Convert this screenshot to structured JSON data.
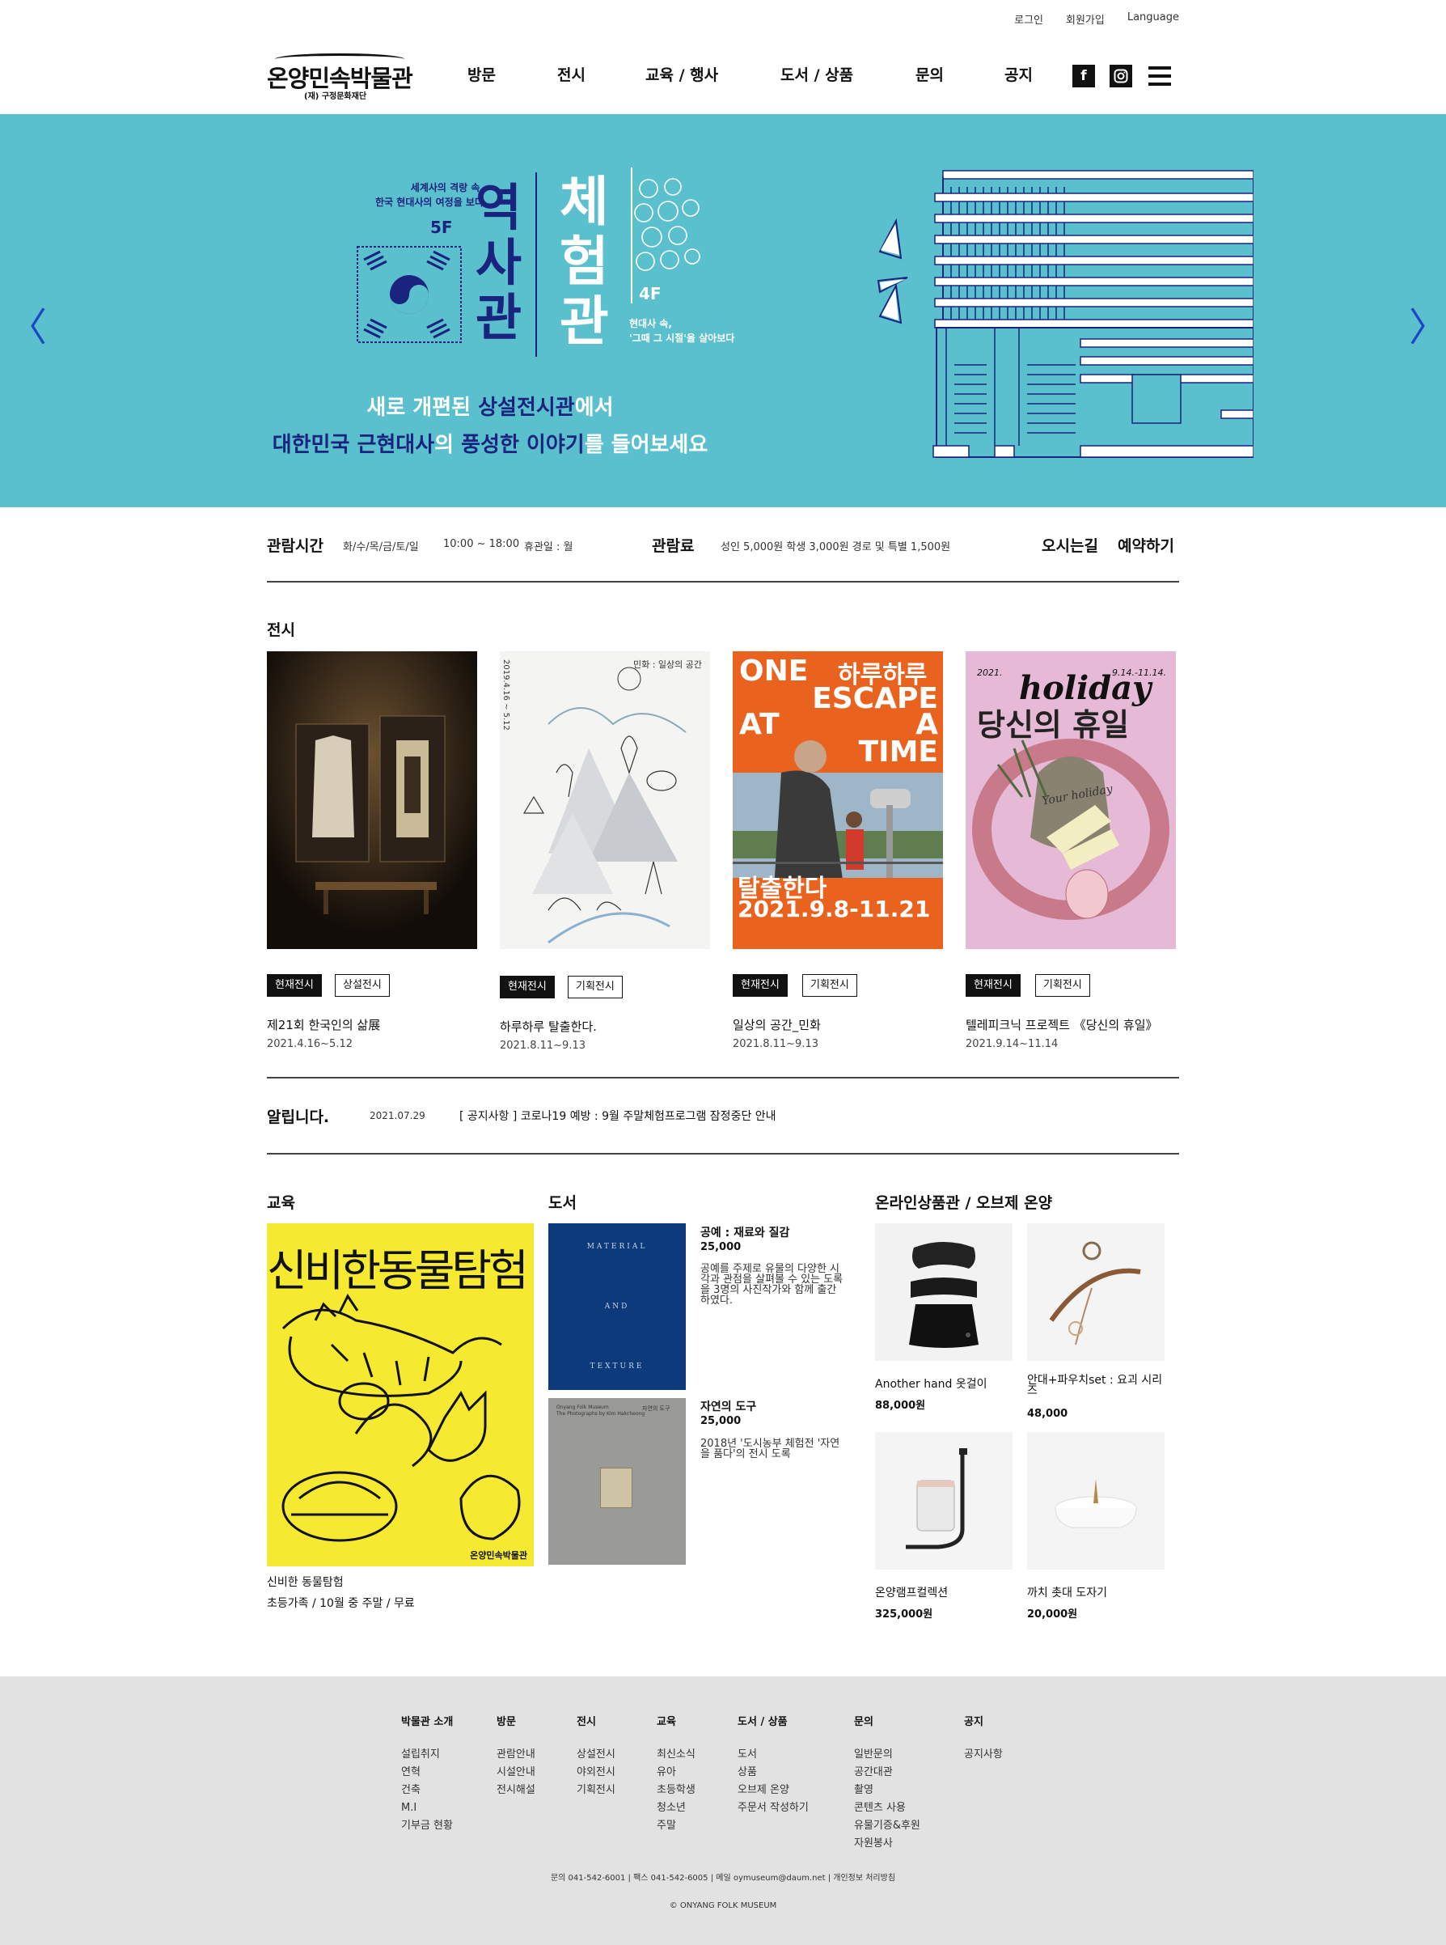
{
  "util": {
    "login": "로그인",
    "join": "회원가입",
    "language": "Language"
  },
  "logo": {
    "title": "온양민속박물관",
    "sub": "(재) 구정문화재단"
  },
  "gnb": [
    "방문",
    "전시",
    "교육 / 행사",
    "도서 / 상품",
    "문의",
    "공지"
  ],
  "sns": {
    "facebook": "f",
    "instagram": "◘"
  },
  "hero": {
    "left_text": "세계사의 격랑 속,\n한국 현대사의 여정을 보다",
    "floor5": "5F",
    "hall1": "역사관",
    "hall2": "체험관",
    "floor4": "4F",
    "right_text": "현대사 속,\n'그때 그 시절'을 살아보다",
    "line1_a": "새로 개편된 ",
    "line1_b": "상설전시관",
    "line1_c": "에서",
    "line2_a": "대한민국 근현대사",
    "line2_b": "의 ",
    "line2_c": "풍성한 이야기",
    "line2_d": "를 들어보세요"
  },
  "info": {
    "hours_title": "관람시간",
    "hours_days": "화/수/목/금/토/일",
    "hours_time": "10:00 ~ 18:00",
    "closed": "휴관일 : 월",
    "fee_title": "관람료",
    "fee": "성인 5,000원 학생 3,000원 경로 및 특별 1,500원",
    "directions": "오시는길",
    "reserve": "예약하기"
  },
  "exhibit": {
    "title": "전시",
    "items": [
      {
        "tag1": "현재전시",
        "tag2": "상설전시",
        "title": "제21회 한국인의 삶展",
        "date": "2021.4.16~5.12"
      },
      {
        "tag1": "현재전시",
        "tag2": "기획전시",
        "title": "하루하루 탈출한다.",
        "date": "2021.8.11~9.13"
      },
      {
        "tag1": "현재전시",
        "tag2": "기획전시",
        "title": "일상의 공간_민화",
        "date": "2021.8.11~9.13"
      },
      {
        "tag1": "현재전시",
        "tag2": "기획전시",
        "title": "텔레피크닉 프로젝트 《당신의 휴일》",
        "date": "2021.9.14~11.14"
      }
    ],
    "poster2_title": "민화 : 일상의 공간",
    "poster2_date": "2019.4.16 ~ 5.12",
    "poster3_lines": [
      "ONE",
      "하루하루",
      "ESCAPE",
      "AT",
      "A",
      "TIME"
    ],
    "poster3_sub": "탈출한다",
    "poster3_date": "2021.9.8-11.21",
    "poster4_top": "holiday",
    "poster4_kr": "당신의 휴일",
    "poster4_year": "2021.",
    "poster4_range": "9.14.-11.14.",
    "poster4_script": "Your holiday"
  },
  "notice": {
    "title": "알립니다.",
    "date": "2021.07.29",
    "text": "[ 공지사항 ] 코로나19 예방 : 9월 주말체험프로그램 잠정중단 안내"
  },
  "education": {
    "title": "교육",
    "poster_title": "신비한동물탐험",
    "poster_brand": "온양민속박물관",
    "item_title": "신비한 동물탐험",
    "item_desc": "초등가족 / 10월 중 주말 / 무료"
  },
  "books": {
    "title": "도서",
    "items": [
      {
        "title": "공예 : 재료와 질감",
        "price": "25,000",
        "desc": "공예를 주제로 유물의 다양한 시각과 관점을 살펴볼 수 있는 도록을 3명의 사진작가와 함께 출간하였다."
      },
      {
        "title": "자연의 도구",
        "price": "25,000",
        "desc": "2018년 '도시농부 체험전 '자연을 품다'의 전시 도록"
      }
    ],
    "cover1": [
      "MATERIAL",
      "AND",
      "TEXTURE"
    ],
    "cover2_top": "Onyang Folk Museum",
    "cover2_sub": "The Photographs by Kim Hakcheong",
    "cover2_right": "자연의 도구"
  },
  "shop": {
    "title": "온라인상품관 / 오브제 온양",
    "items": [
      {
        "name": "Another hand 옷걸이",
        "price": "88,000원"
      },
      {
        "name": "안대+파우치set : 요괴 시리즈",
        "price": "48,000"
      },
      {
        "name": "온양램프컬렉션",
        "price": "325,000원"
      },
      {
        "name": "까치 촛대 도자기",
        "price": "20,000원"
      }
    ]
  },
  "footer": {
    "cols": [
      {
        "h": "박물관 소개",
        "items": [
          "설립취지",
          "연혁",
          "건축",
          "M.I",
          "기부금 현황"
        ]
      },
      {
        "h": "방문",
        "items": [
          "관람안내",
          "시설안내",
          "전시해설"
        ]
      },
      {
        "h": "전시",
        "items": [
          "상설전시",
          "야외전시",
          "기획전시"
        ]
      },
      {
        "h": "교육",
        "items": [
          "최신소식",
          "유아",
          "초등학생",
          "청소년",
          "주말"
        ]
      },
      {
        "h": "도서 / 상품",
        "items": [
          "도서",
          "상품",
          "오브제 온양",
          "주문서 작성하기"
        ]
      },
      {
        "h": "문의",
        "items": [
          "일반문의",
          "공간대관",
          "촬영",
          "콘텐츠 사용",
          "유물기증&후원",
          "자원봉사"
        ]
      },
      {
        "h": "공지",
        "items": [
          "공지사항"
        ]
      }
    ],
    "info": "문의 041-542-6001  |  팩스 041-542-6005  |  메일 oymuseum@daum.net  |  개인정보 처리방침",
    "copy": "© ONYANG FOLK MUSEUM"
  },
  "colors": {
    "hero_bg": "#5bc0ce",
    "navy": "#1a237e",
    "footer_bg": "#e2e2e2",
    "edu_yellow": "#f5ea2f",
    "book_blue": "#0d3a7a"
  }
}
